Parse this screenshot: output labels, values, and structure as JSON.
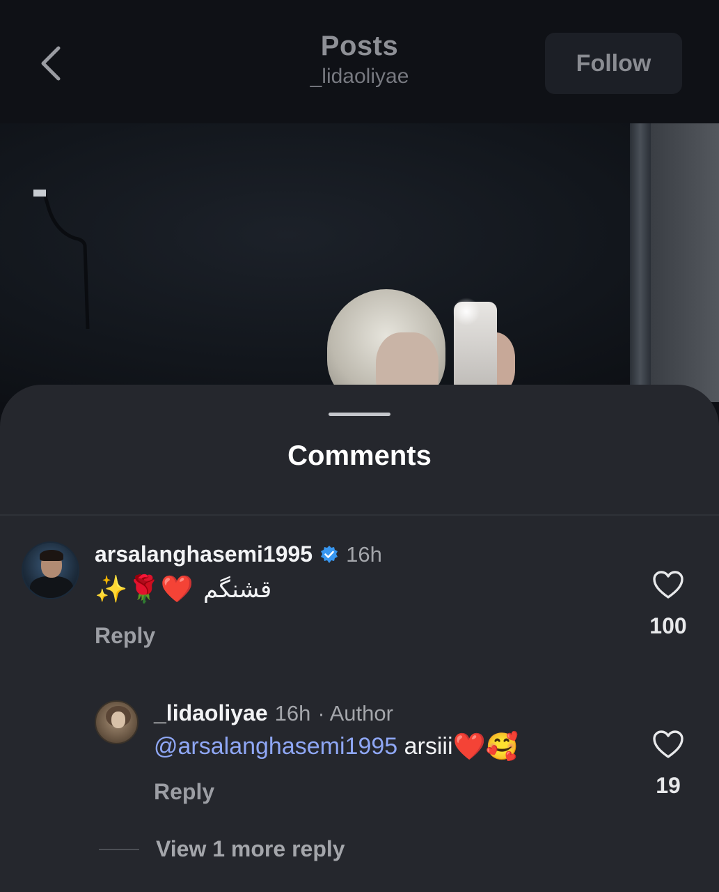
{
  "header": {
    "title": "Posts",
    "subtitle": "_lidaoliyae",
    "follow_label": "Follow"
  },
  "comments_sheet": {
    "title": "Comments",
    "comment": {
      "username": "arsalanghasemi1995",
      "verified": true,
      "time": "16h",
      "text": "قشنگم",
      "emojis": "✨🌹❤️",
      "reply_label": "Reply",
      "likes": "100"
    },
    "reply": {
      "username": "_lidaoliyae",
      "time": "16h",
      "author_tag": "· Author",
      "mention": "@arsalanghasemi1995",
      "text": " arsiii",
      "emojis": "❤️🥰",
      "reply_label": "Reply",
      "likes": "19"
    },
    "view_more_label": "View 1 more reply"
  },
  "colors": {
    "background": "#0d0f14",
    "sheet": "#25272d",
    "mention": "#8fa7f5",
    "verified": "#3897f0"
  }
}
